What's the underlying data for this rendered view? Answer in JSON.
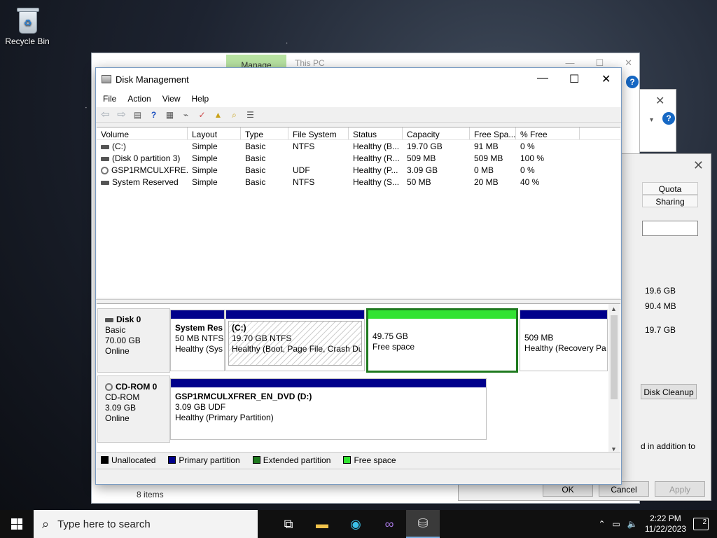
{
  "desktop": {
    "recycle_bin_label": "Recycle Bin"
  },
  "explorer": {
    "manage_tab": "Manage",
    "title": "This PC",
    "status": "8 items"
  },
  "properties": {
    "tabs": [
      "Quota",
      "Sharing"
    ],
    "values": [
      "19.6 GB",
      "90.4 MB",
      "19.7 GB"
    ],
    "disk_cleanup": "Disk Cleanup",
    "note": "d in addition to",
    "ok": "OK",
    "cancel": "Cancel",
    "apply": "Apply"
  },
  "dm": {
    "title": "Disk Management",
    "menu": [
      "File",
      "Action",
      "View",
      "Help"
    ],
    "columns": [
      "Volume",
      "Layout",
      "Type",
      "File System",
      "Status",
      "Capacity",
      "Free Spa...",
      "% Free"
    ],
    "volumes": [
      {
        "icon": "drive",
        "name": "(C:)",
        "layout": "Simple",
        "type": "Basic",
        "fs": "NTFS",
        "status": "Healthy (B...",
        "capacity": "19.70 GB",
        "free": "91 MB",
        "pct": "0 %"
      },
      {
        "icon": "drive",
        "name": "(Disk 0 partition 3)",
        "layout": "Simple",
        "type": "Basic",
        "fs": "",
        "status": "Healthy (R...",
        "capacity": "509 MB",
        "free": "509 MB",
        "pct": "100 %"
      },
      {
        "icon": "cd",
        "name": "GSP1RMCULXFRE...",
        "layout": "Simple",
        "type": "Basic",
        "fs": "UDF",
        "status": "Healthy (P...",
        "capacity": "3.09 GB",
        "free": "0 MB",
        "pct": "0 %"
      },
      {
        "icon": "drive",
        "name": "System Reserved",
        "layout": "Simple",
        "type": "Basic",
        "fs": "NTFS",
        "status": "Healthy (S...",
        "capacity": "50 MB",
        "free": "20 MB",
        "pct": "40 %"
      }
    ],
    "disk0": {
      "name": "Disk 0",
      "type": "Basic",
      "size": "70.00 GB",
      "state": "Online",
      "p1": {
        "name": "System Res",
        "line2": "50 MB NTFS",
        "line3": "Healthy (Sys"
      },
      "p2": {
        "name": "(C:)",
        "line2": "19.70 GB NTFS",
        "line3": "Healthy (Boot, Page File, Crash Dur"
      },
      "p3": {
        "line1": "49.75 GB",
        "line2": "Free space"
      },
      "p4": {
        "line1": "509 MB",
        "line2": "Healthy (Recovery Pa"
      }
    },
    "cdrom0": {
      "name": "CD-ROM 0",
      "type": "CD-ROM",
      "size": "3.09 GB",
      "state": "Online",
      "p1": {
        "name": "GSP1RMCULXFRER_EN_DVD  (D:)",
        "line2": "3.09 GB UDF",
        "line3": "Healthy (Primary Partition)"
      }
    },
    "legend": [
      {
        "label": "Unallocated",
        "color": "#000000"
      },
      {
        "label": "Primary partition",
        "color": "#00008b"
      },
      {
        "label": "Extended partition",
        "color": "#1f7a1f"
      },
      {
        "label": "Free space",
        "color": "#32e332"
      }
    ]
  },
  "taskbar": {
    "search_placeholder": "Type here to search",
    "time": "2:22 PM",
    "date": "11/22/2023",
    "notifications": "2"
  }
}
